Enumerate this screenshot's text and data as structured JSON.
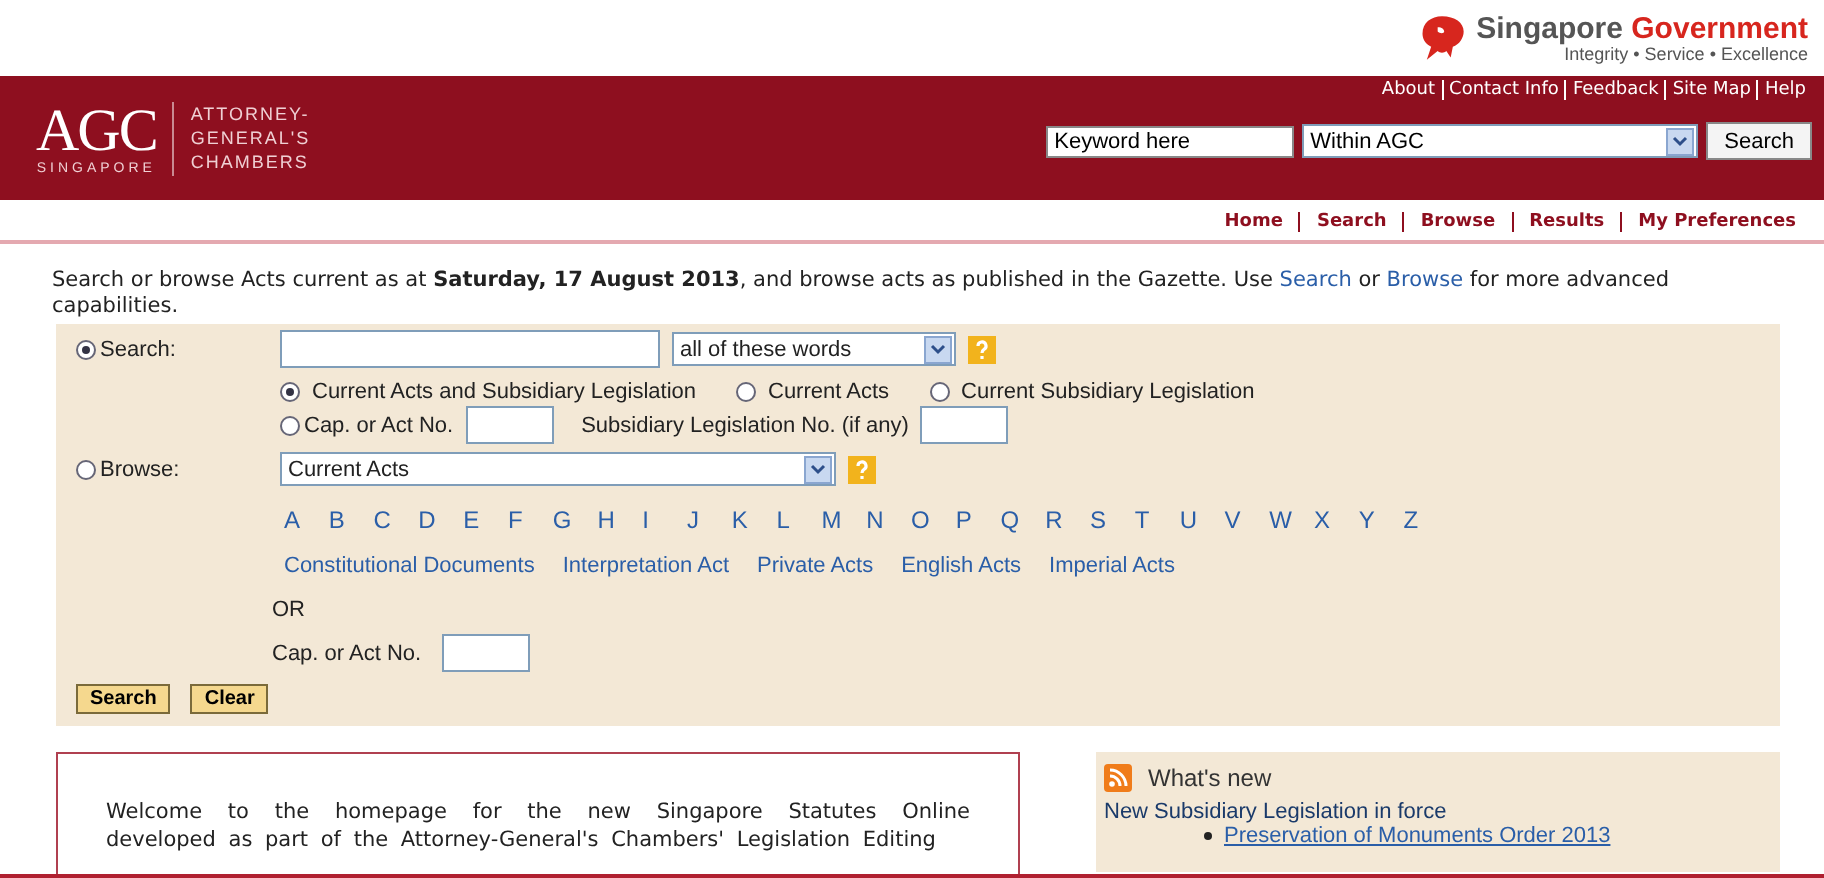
{
  "gov_brand": {
    "name": "Singapore",
    "name_accent": "Government",
    "tagline": "Integrity • Service • Excellence"
  },
  "header": {
    "logo_mark": "AGC",
    "logo_sub": "SINGAPORE",
    "logo_name": [
      "ATTORNEY-",
      "GENERAL'S",
      "CHAMBERS"
    ],
    "top_links": [
      "About",
      "Contact Info",
      "Feedback",
      "Site Map",
      "Help"
    ],
    "keyword": {
      "placeholder": "Keyword here"
    },
    "scope": "Within AGC",
    "search_button": "Search"
  },
  "nav": [
    "Home",
    "Search",
    "Browse",
    "Results",
    "My Preferences"
  ],
  "intro": [
    {
      "kind": "text",
      "text": "Search or browse Acts current as at "
    },
    {
      "kind": "bold",
      "text": "Saturday, 17 August 2013"
    },
    {
      "kind": "text",
      "text": ", and browse acts as published in the Gazette. Use "
    },
    {
      "kind": "link",
      "text": "Search"
    },
    {
      "kind": "text",
      "text": " or "
    },
    {
      "kind": "link",
      "text": "Browse"
    },
    {
      "kind": "text",
      "text": " for more advanced capabilities."
    }
  ],
  "search": {
    "label": "Search:",
    "selected": true,
    "match": "all of these words",
    "scopes": [
      {
        "label": "Current Acts and Subsidiary Legislation",
        "selected": true
      },
      {
        "label": "Current Acts",
        "selected": false
      },
      {
        "label": "Current Subsidiary Legislation",
        "selected": false
      }
    ],
    "cap": {
      "label": "Cap. or Act No.",
      "selected": false
    },
    "sub_label": "Subsidiary Legislation No. (if any)"
  },
  "browse": {
    "label": "Browse:",
    "selected": false,
    "category": "Current Acts",
    "letters": [
      "A",
      "B",
      "C",
      "D",
      "E",
      "F",
      "G",
      "H",
      "I",
      "J",
      "K",
      "L",
      "M",
      "N",
      "O",
      "P",
      "Q",
      "R",
      "S",
      "T",
      "U",
      "V",
      "W",
      "X",
      "Y",
      "Z"
    ],
    "collections": [
      "Constitutional Documents",
      "Interpretation Act",
      "Private Acts",
      "English Acts",
      "Imperial Acts"
    ],
    "or_label": "OR",
    "cap_label": "Cap. or Act No."
  },
  "buttons": [
    "Search",
    "Clear"
  ],
  "welcome": "Welcome to the homepage for the new Singapore Statutes Online developed as part of the Attorney-General's Chambers' Legislation Editing",
  "whats_new": {
    "title": "What's new",
    "heading": "New Subsidiary Legislation in force",
    "items": [
      "Preservation of Monuments Order 2013"
    ]
  }
}
